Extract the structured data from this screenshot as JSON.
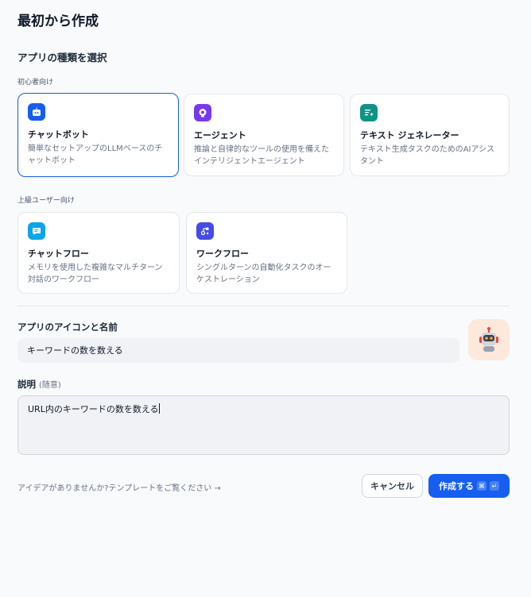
{
  "title": "最初から作成",
  "type_section": {
    "heading": "アプリの種類を選択",
    "beginner_label": "初心者向け",
    "advanced_label": "上級ユーザー向け",
    "cards": [
      {
        "title": "チャットボット",
        "desc": "簡単なセットアップのLLMベースのチャットボット",
        "icon": "chatbot-icon",
        "color": "#155eef",
        "selected": true
      },
      {
        "title": "エージェント",
        "desc": "推論と自律的なツールの使用を備えたインテリジェントエージェント",
        "icon": "agent-icon",
        "color": "#7839ee",
        "selected": false
      },
      {
        "title": "テキスト ジェネレーター",
        "desc": "テキスト生成タスクのためのAIアシスタント",
        "icon": "text-generator-icon",
        "color": "#0e9384",
        "selected": false
      },
      {
        "title": "チャットフロー",
        "desc": "メモリを使用した複雑なマルチターン対話のワークフロー",
        "icon": "chatflow-icon",
        "color": "#0ba5ec",
        "selected": false
      },
      {
        "title": "ワークフロー",
        "desc": "シングルターンの自動化タスクのオーケストレーション",
        "icon": "workflow-icon",
        "color": "#444ce7",
        "selected": false
      }
    ]
  },
  "name_section": {
    "label": "アプリのアイコンと名前",
    "value": "キーワードの数を数える",
    "avatar_icon": "robot-icon",
    "avatar_bg": "#fde9dc"
  },
  "description_section": {
    "label": "説明",
    "optional": "(随意)",
    "value": "URL内のキーワードの数を数える"
  },
  "footer": {
    "hint": "アイデアがありませんか?テンプレートをご覧ください →",
    "cancel": "キャンセル",
    "create": "作成する",
    "shortcut_cmd": "⌘",
    "shortcut_enter": "↵"
  },
  "accent": "#155eef"
}
